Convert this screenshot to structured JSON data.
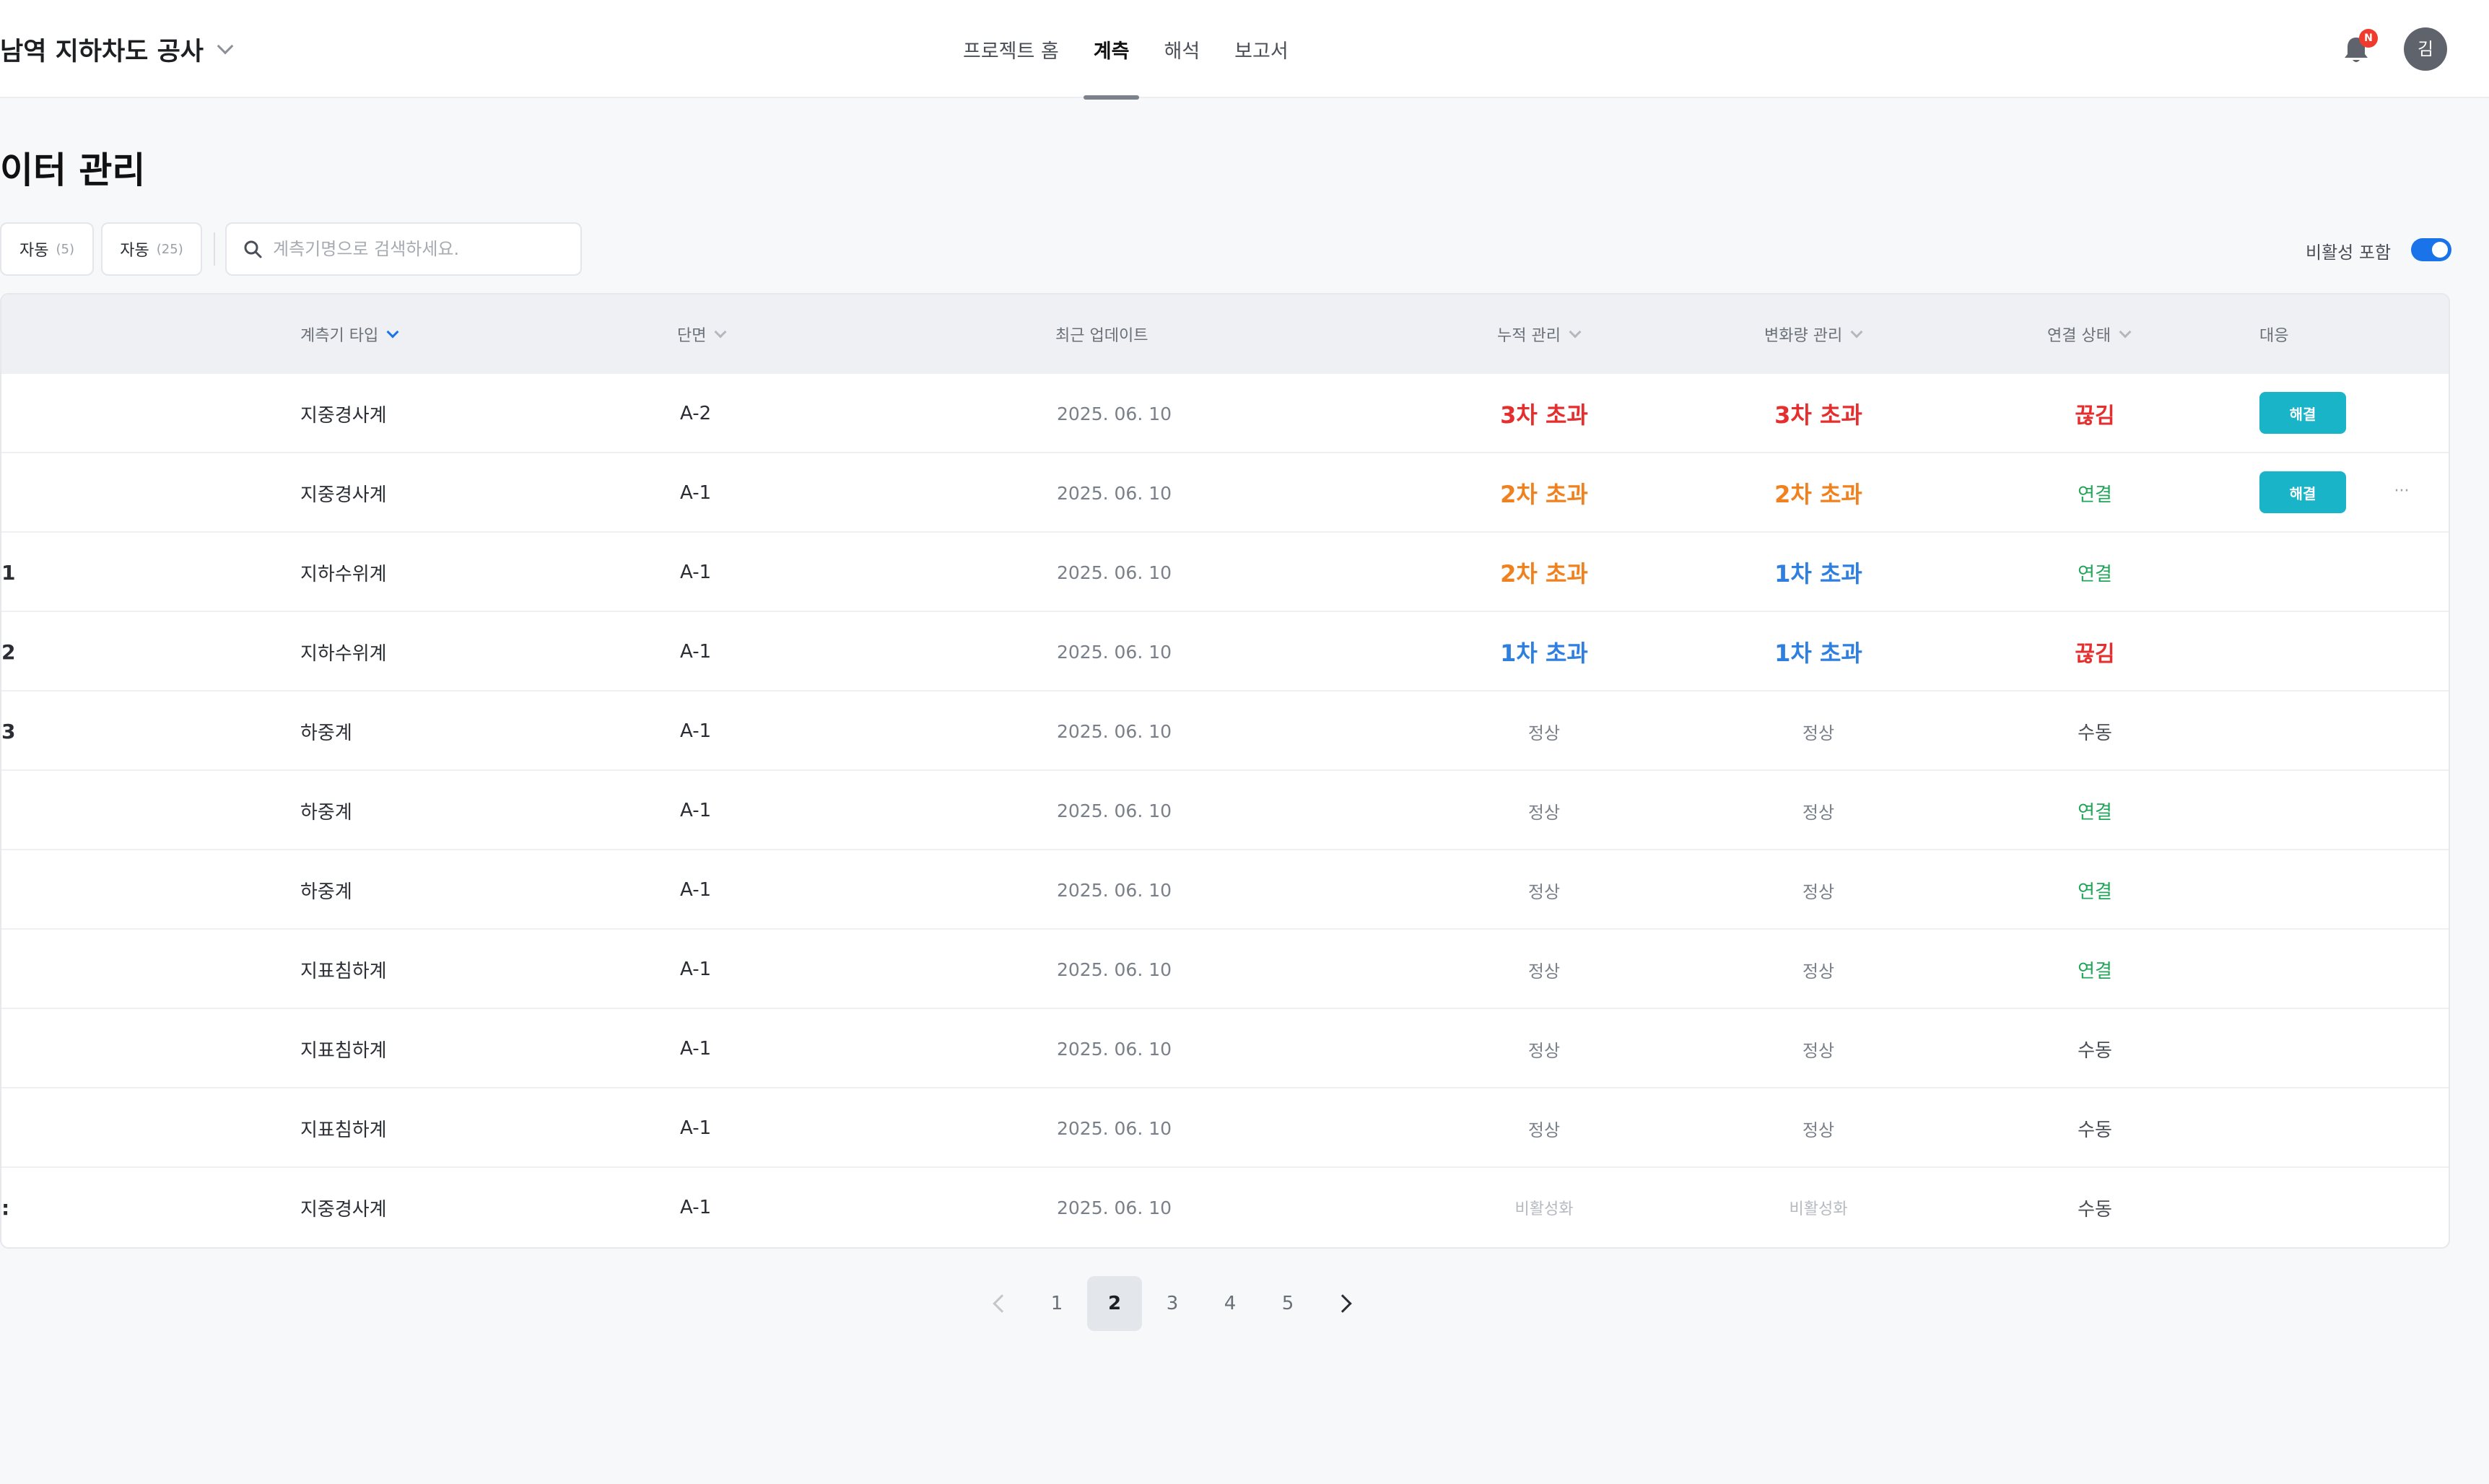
{
  "header": {
    "project_title": "남역 지하차도 공사",
    "nav_tabs": [
      {
        "label": "프로젝트 홈"
      },
      {
        "label": "계측"
      },
      {
        "label": "해석"
      },
      {
        "label": "보고서"
      }
    ],
    "active_tab": "계측",
    "notification_badge": "N",
    "avatar_initial": "김"
  },
  "page": {
    "title": "이터 관리"
  },
  "filters": {
    "chip1": {
      "label": "자동",
      "count": "(5)"
    },
    "chip2": {
      "label": "자동",
      "count": "(25)"
    },
    "search_placeholder": "계측기명으로 검색하세요.",
    "inactive_toggle_label": "비활성 포함",
    "inactive_toggle_on": true
  },
  "table": {
    "headers": {
      "type": "계측기 타입",
      "section": "단면",
      "updated": "최근 업데이트",
      "cumulative": "누적 관리",
      "change": "변화량 관리",
      "connection": "연결 상태",
      "action": "대응"
    },
    "action_button_label": "해결",
    "more_label": "···",
    "rows": [
      {
        "name": "",
        "type": "지중경사계",
        "section": "A-2",
        "updated": "2025. 06. 10",
        "cumulative": "3차 초과",
        "change": "3차 초과",
        "connection": "끊김",
        "action": "해결"
      },
      {
        "name": "",
        "type": "지중경사계",
        "section": "A-1",
        "updated": "2025. 06. 10",
        "cumulative": "2차 초과",
        "change": "2차 초과",
        "connection": "연결",
        "action": "해결"
      },
      {
        "name": "1",
        "type": "지하수위계",
        "section": "A-1",
        "updated": "2025. 06. 10",
        "cumulative": "2차 초과",
        "change": "1차 초과",
        "connection": "연결",
        "action": ""
      },
      {
        "name": "2",
        "type": "지하수위계",
        "section": "A-1",
        "updated": "2025. 06. 10",
        "cumulative": "1차 초과",
        "change": "1차 초과",
        "connection": "끊김",
        "action": ""
      },
      {
        "name": "3",
        "type": "하중계",
        "section": "A-1",
        "updated": "2025. 06. 10",
        "cumulative": "정상",
        "change": "정상",
        "connection": "수동",
        "action": ""
      },
      {
        "name": "",
        "type": "하중계",
        "section": "A-1",
        "updated": "2025. 06. 10",
        "cumulative": "정상",
        "change": "정상",
        "connection": "연결",
        "action": ""
      },
      {
        "name": "",
        "type": "하중계",
        "section": "A-1",
        "updated": "2025. 06. 10",
        "cumulative": "정상",
        "change": "정상",
        "connection": "연결",
        "action": ""
      },
      {
        "name": "",
        "type": "지표침하계",
        "section": "A-1",
        "updated": "2025. 06. 10",
        "cumulative": "정상",
        "change": "정상",
        "connection": "연결",
        "action": ""
      },
      {
        "name": "",
        "type": "지표침하계",
        "section": "A-1",
        "updated": "2025. 06. 10",
        "cumulative": "정상",
        "change": "정상",
        "connection": "수동",
        "action": ""
      },
      {
        "name": "",
        "type": "지표침하계",
        "section": "A-1",
        "updated": "2025. 06. 10",
        "cumulative": "정상",
        "change": "정상",
        "connection": "수동",
        "action": ""
      },
      {
        "name": ":",
        "type": "지중경사계",
        "section": "A-1",
        "updated": "2025. 06. 10",
        "cumulative": "비활성화",
        "change": "비활성화",
        "connection": "수동",
        "action": ""
      }
    ]
  },
  "pagination": {
    "pages": [
      "1",
      "2",
      "3",
      "4",
      "5"
    ],
    "current": "2"
  },
  "colors": {
    "accent": "#1a73e8",
    "resolve_button": "#19b4c8",
    "level3": "#e52f2f",
    "level2": "#f0811f",
    "level1": "#2e7fe0",
    "connected": "#22a55a"
  }
}
